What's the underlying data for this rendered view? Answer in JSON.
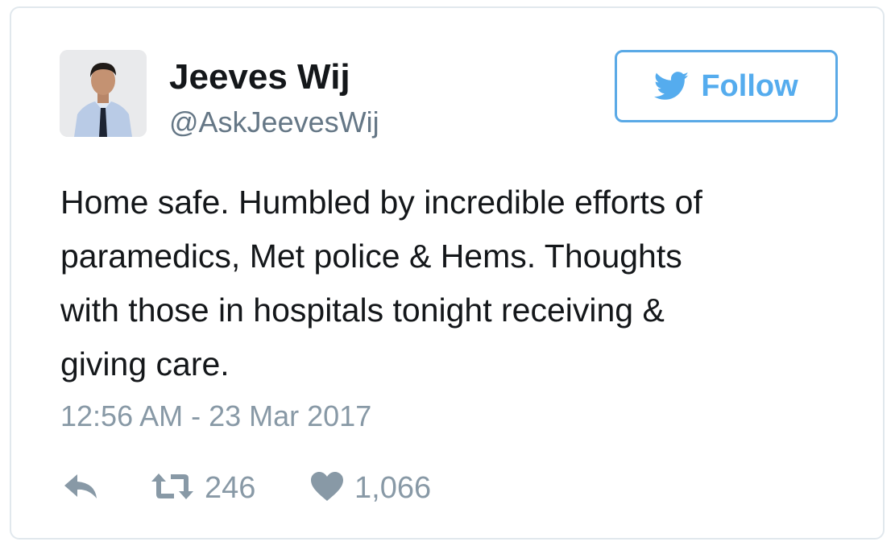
{
  "author": {
    "name": "Jeeves Wij",
    "handle": "@AskJeevesWij"
  },
  "follow_button": {
    "label": "Follow",
    "icon": "twitter-bird-icon",
    "color": "#55acee"
  },
  "tweet": {
    "text_lines": [
      "Home safe. Humbled by incredible efforts of",
      "paramedics, Met police & Hems. Thoughts",
      "with those in hospitals tonight receiving &",
      "giving care."
    ],
    "timestamp": "12:56 AM - 23 Mar 2017"
  },
  "actions": {
    "reply": {
      "icon": "reply-icon"
    },
    "retweet": {
      "icon": "retweet-icon",
      "count": "246"
    },
    "like": {
      "icon": "heart-icon",
      "count": "1,066"
    }
  },
  "colors": {
    "text": "#14171a",
    "muted": "#8899a6",
    "handle": "#657786",
    "border": "#e1e8ed",
    "accent": "#55acee"
  }
}
